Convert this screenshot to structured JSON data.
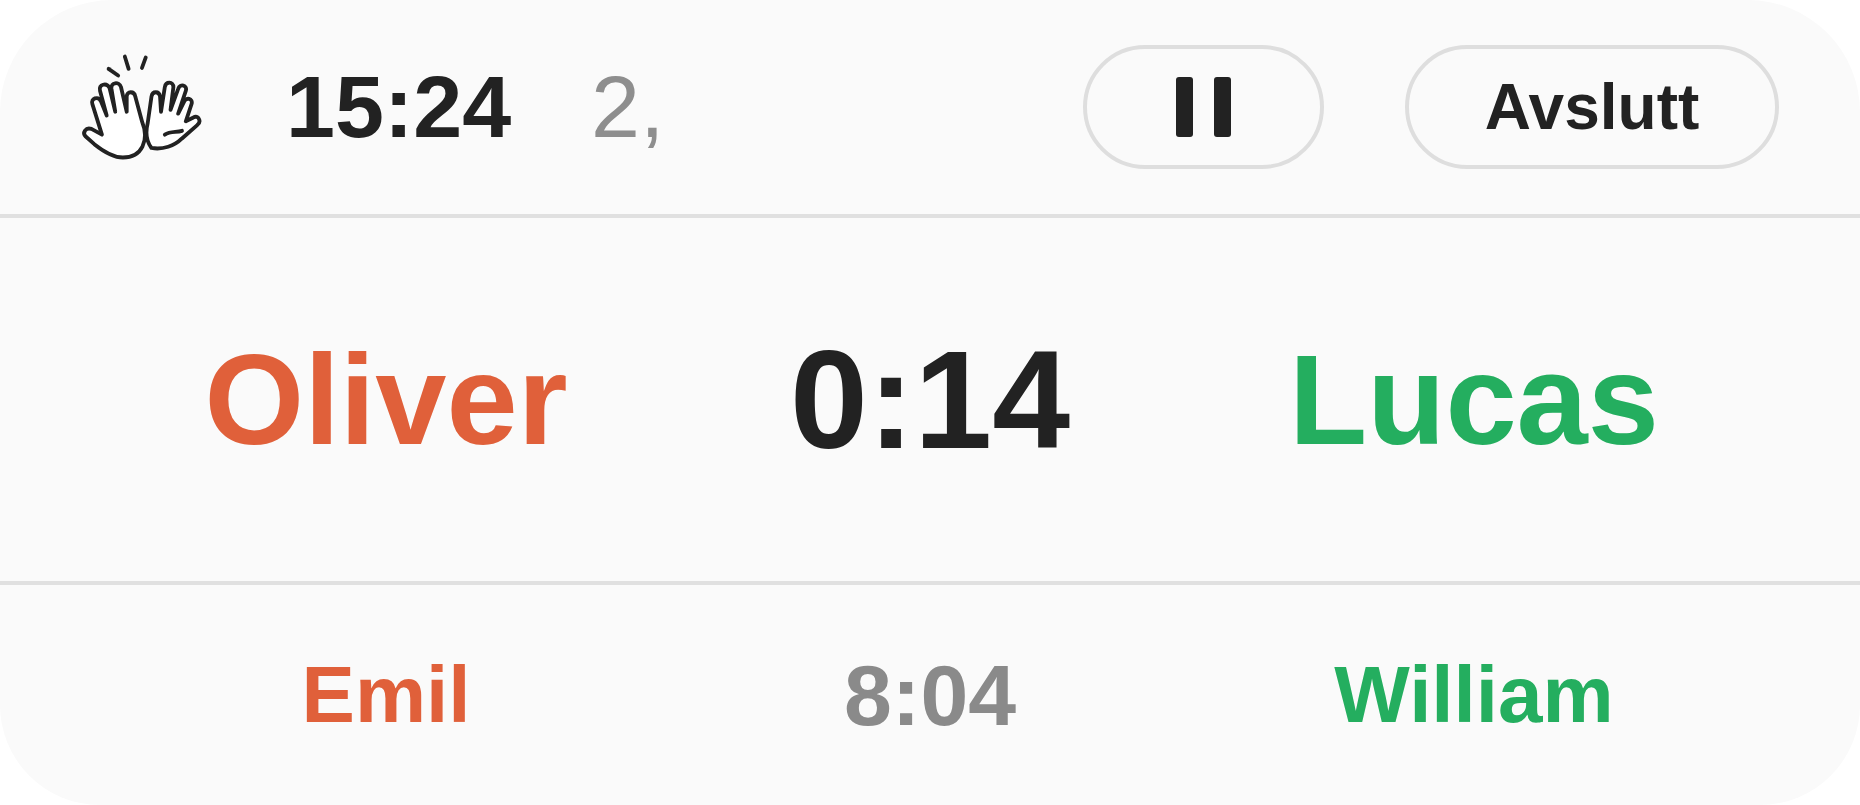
{
  "header": {
    "time": "15:24",
    "status_text": "2,",
    "buttons": [
      {
        "kind": "pause"
      },
      {
        "kind": "text",
        "label": "Avslutt"
      }
    ]
  },
  "current_match": {
    "players": [
      {
        "name": "Oliver",
        "color": "#e0603a"
      },
      {
        "name": "Lucas",
        "color": "#24ae5f"
      }
    ],
    "time": "0:14"
  },
  "next_match": {
    "players": [
      {
        "name": "Emil",
        "color": "#e0603a"
      },
      {
        "name": "William",
        "color": "#24ae5f"
      }
    ],
    "time": "8:04"
  }
}
